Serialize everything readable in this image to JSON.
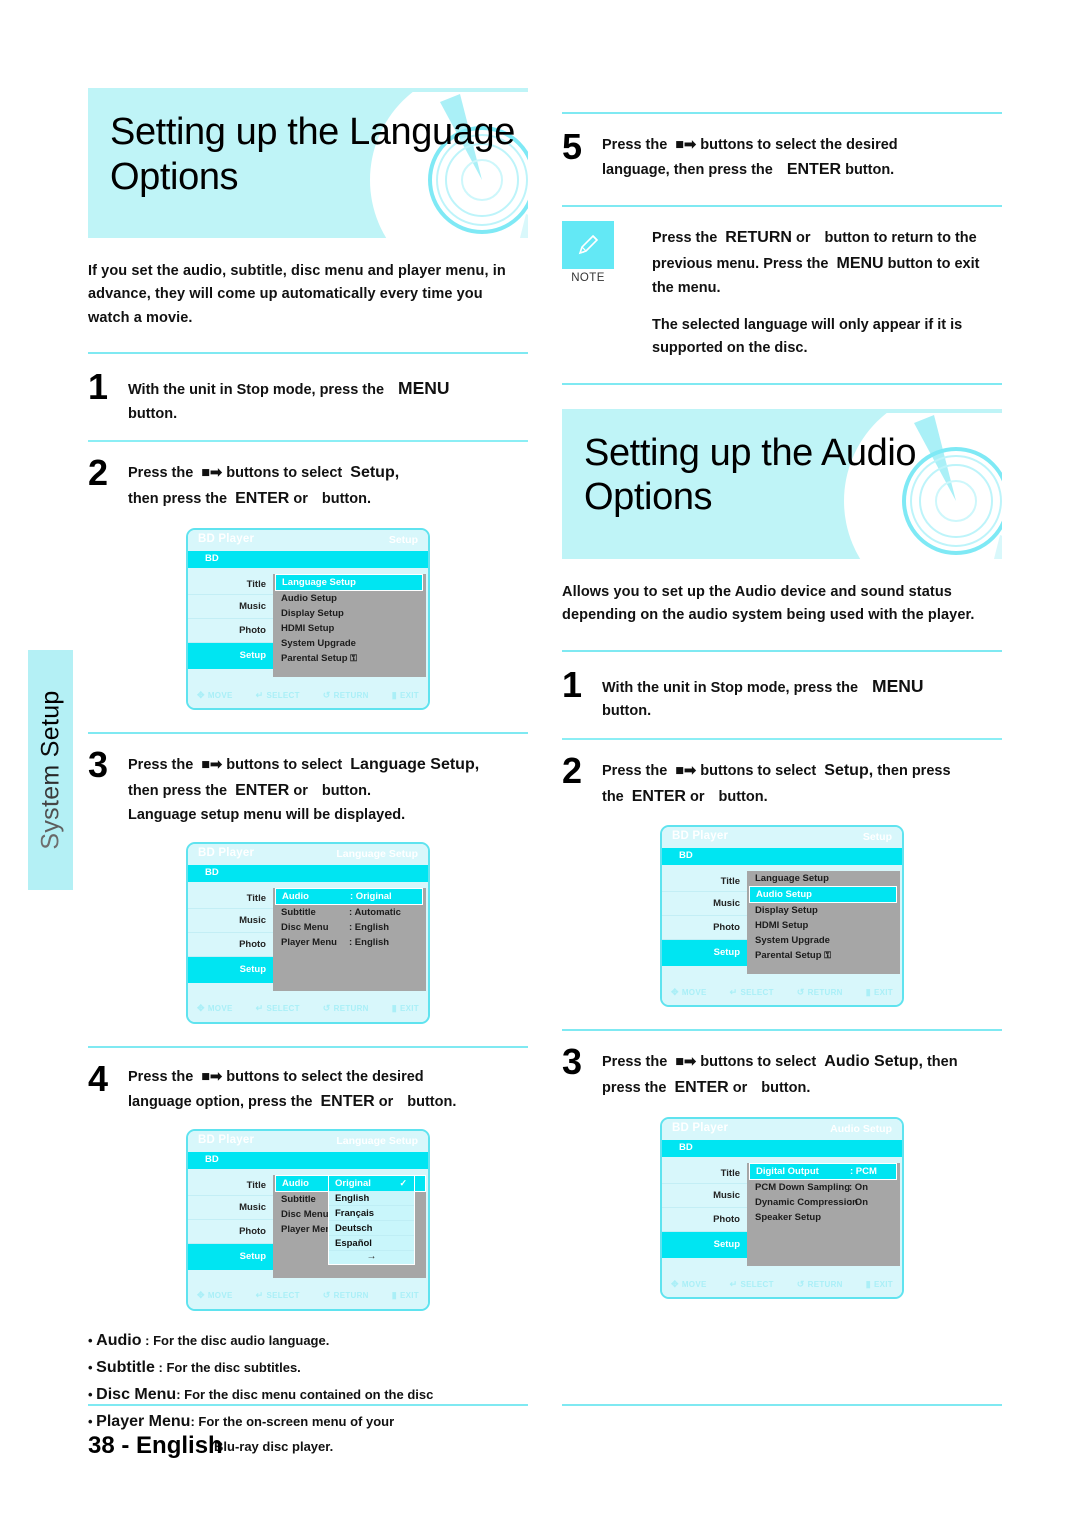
{
  "side_tab": {
    "label": "System Setup"
  },
  "colors": {
    "banner_bg": "#bff4f7",
    "accent_cyan": "#00e5f2",
    "rule": "#7fe9f2",
    "osd_panel_gray": "#a6a6a6",
    "osd_bg": "#d8f7fb"
  },
  "left": {
    "banner_title": "Setting up the Language Options",
    "intro": "If you set the audio, subtitle, disc menu and player menu, in advance, they will come up automatically every time you watch a movie.",
    "step1": {
      "num": "1",
      "pre": "With the unit in Stop mode, press the",
      "kw": "MENU",
      "post": "button."
    },
    "step2": {
      "num": "2",
      "pre": "Press the",
      "icons": "■➡",
      "mid": "buttons to select",
      "kw1": "Setup,",
      "pre2": "then press the",
      "kw2": "ENTER",
      "or": "or",
      "post": "button."
    },
    "step3": {
      "num": "3",
      "pre": "Press the",
      "icons": "■➡",
      "mid": "buttons to select",
      "kw1": "Language Setup,",
      "pre2": "then press the",
      "kw2": "ENTER",
      "or": "or",
      "post": "button.",
      "line3": "Language setup menu will be displayed."
    },
    "step4": {
      "num": "4",
      "pre": "Press the",
      "icons": "■➡",
      "mid": "buttons to select the desired",
      "pre2": "language option, press the",
      "kw2": "ENTER",
      "or": "or",
      "post": "button."
    },
    "bullets": [
      {
        "term": "Audio",
        "sep": ":",
        "desc": "For the disc audio language."
      },
      {
        "term": "Subtitle",
        "sep": ":",
        "desc": "For the disc subtitles."
      },
      {
        "term": "Disc Menu",
        "sep": ":",
        "desc": "For the disc menu contained on the disc"
      },
      {
        "term": "Player Menu",
        "sep": ":",
        "desc": "For the on-screen menu of your",
        "cont": "Blu-ray disc player."
      }
    ]
  },
  "right": {
    "step5": {
      "num": "5",
      "pre": "Press the",
      "icons": "■➡",
      "mid": "buttons to select the desired",
      "pre2": "language, then press the",
      "kw2": "ENTER",
      "post": "button."
    },
    "note": {
      "label": "NOTE",
      "p1_a": "Press the",
      "p1_kw1": "RETURN",
      "p1_b": "or",
      "p1_c": "button to return to the previous menu. Press the",
      "p1_kw2": "MENU",
      "p1_d": "button to exit the menu.",
      "p2": "The selected language will only appear if it is supported on the disc."
    },
    "banner_title": "Setting up the Audio Options",
    "intro": "Allows you to set up the Audio device and sound status depending on the audio system being used with the player.",
    "step1": {
      "num": "1",
      "pre": "With the unit in Stop mode, press the",
      "kw": "MENU",
      "post": "button."
    },
    "step2": {
      "num": "2",
      "pre": "Press the",
      "icons": "■➡",
      "mid": "buttons to select",
      "kw1": "Setup,",
      "tail": "then press",
      "pre2": "the",
      "kw2": "ENTER",
      "or": "or",
      "post": "button."
    },
    "step3": {
      "num": "3",
      "pre": "Press the",
      "icons": "■➡",
      "mid": "buttons to select",
      "kw1": "Audio Setup,",
      "tail": "then",
      "pre2": "press the",
      "kw2": "ENTER",
      "or": "or",
      "post": "button."
    }
  },
  "osd": {
    "brand": "BD Player",
    "bd_tab": "BD",
    "side_items": [
      "Title",
      "Music",
      "Photo",
      "Setup"
    ],
    "footer": [
      {
        "icon": "✥",
        "label": "MOVE"
      },
      {
        "icon": "↵",
        "label": "SELECT"
      },
      {
        "icon": "↺",
        "label": "RETURN"
      },
      {
        "icon": "▮",
        "label": "EXIT"
      }
    ],
    "setup_menu": {
      "mode": "Setup",
      "rows": [
        {
          "label": "Language Setup"
        },
        {
          "label": "Audio Setup"
        },
        {
          "label": "Display Setup"
        },
        {
          "label": "HDMI Setup"
        },
        {
          "label": "System Upgrade"
        },
        {
          "label": "Parental Setup",
          "lock": "⚿"
        }
      ],
      "highlight_language": 0,
      "highlight_audio": 1
    },
    "language_setup": {
      "mode": "Language Setup",
      "rows": [
        {
          "label": "Audio",
          "value": ": Original"
        },
        {
          "label": "Subtitle",
          "value": ": Automatic"
        },
        {
          "label": "Disc Menu",
          "value": ": English"
        },
        {
          "label": "Player Menu",
          "value": ": English"
        }
      ]
    },
    "language_dropdown": {
      "mode": "Language Setup",
      "rows": [
        {
          "label": "Audio"
        },
        {
          "label": "Subtitle"
        },
        {
          "label": "Disc Menu"
        },
        {
          "label": "Player Menu"
        }
      ],
      "options": [
        "Original",
        "English",
        "Français",
        "Deutsch",
        "Español"
      ],
      "checked": "Original",
      "check_glyph": "✓",
      "more_glyph": "→"
    },
    "audio_setup": {
      "mode": "Audio Setup",
      "rows": [
        {
          "label": "Digital Output",
          "value": ": PCM"
        },
        {
          "label": "PCM Down Sampling",
          "value": ": On"
        },
        {
          "label": "Dynamic Compression",
          "value": ": On"
        },
        {
          "label": "Speaker Setup",
          "value": ""
        }
      ]
    }
  },
  "footer": {
    "page": "38",
    "dash": "-",
    "language": "English"
  }
}
